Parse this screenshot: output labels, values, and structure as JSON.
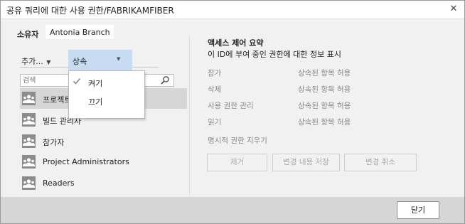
{
  "dialog": {
    "title": "공유 쿼리에 대한 사용 권한/FABRIKAMFIBER",
    "close_glyph": "✕"
  },
  "owner": {
    "label": "소유자",
    "value": "Antonia Branch"
  },
  "toolbar": {
    "add_label": "추가...",
    "permission_select_value": "상속"
  },
  "search": {
    "placeholder": "검색"
  },
  "identities": [
    {
      "label": "프로젝트 관리자",
      "icon": "group-icon",
      "selected": true
    },
    {
      "label": "빌드 관리자",
      "icon": "group-icon",
      "selected": false
    },
    {
      "label": "참가자",
      "icon": "group-icon",
      "selected": false
    },
    {
      "label": "Project Administrators",
      "icon": "group-icon",
      "selected": false
    },
    {
      "label": "Readers",
      "icon": "group-icon",
      "selected": false
    }
  ],
  "dropdown": {
    "options": [
      {
        "label": "켜기",
        "checked": true
      },
      {
        "label": "끄기",
        "checked": false
      }
    ]
  },
  "summary": {
    "title": "액세스 제어 요약",
    "subtitle": "이 ID에 부여 중인 권한에 대한 정보 표시",
    "permissions": [
      {
        "name": "참가",
        "value": "상속된 항목 허용"
      },
      {
        "name": "삭제",
        "value": "상속된 항목 허용"
      },
      {
        "name": "사용 권한 관리",
        "value": "상속된 항목 허용"
      },
      {
        "name": "읽기",
        "value": "상속된 항목 허용"
      }
    ],
    "clear_link": "명시적 권한 지우기",
    "buttons": {
      "remove": "제거",
      "save": "변경 내용 저장",
      "undo": "변경 취소"
    }
  },
  "footer": {
    "close_button": "닫기"
  },
  "colors": {
    "selection_blue": "#c7dcf2",
    "selected_row": "#d6d6d6",
    "footer_bg": "#d6d6d6",
    "disabled_text": "#a8a8a8"
  }
}
